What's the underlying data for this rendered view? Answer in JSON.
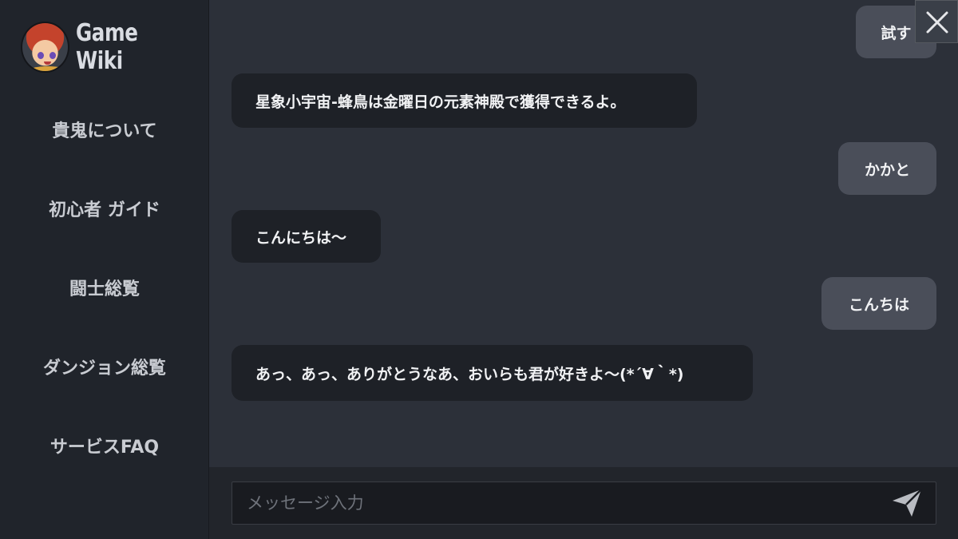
{
  "app": {
    "title": "Game Wiki"
  },
  "sidebar": {
    "items": [
      {
        "label": "貴鬼について"
      },
      {
        "label": "初心者 ガイド"
      },
      {
        "label": "闘士総覧"
      },
      {
        "label": "ダンジョン総覧"
      },
      {
        "label": "サービスFAQ"
      }
    ]
  },
  "chat": {
    "messages": [
      {
        "role": "user",
        "text": "試す"
      },
      {
        "role": "bot",
        "text": "星象小宇宙-蜂鳥は金曜日の元素神殿で獲得できるよ。"
      },
      {
        "role": "user",
        "text": "かかと"
      },
      {
        "role": "bot",
        "text": "こんにちは〜"
      },
      {
        "role": "user",
        "text": "こんちは"
      },
      {
        "role": "bot",
        "text": "あっ、あっ、ありがとうなあ、おいらも君が好きよ〜(*´∀｀*)"
      }
    ]
  },
  "composer": {
    "placeholder": "メッセージ入力",
    "value": ""
  },
  "icons": {
    "close": "close-icon",
    "send": "send-icon",
    "avatar": "avatar-icon"
  },
  "colors": {
    "background": "#2c3039",
    "sidebar": "#20242b",
    "user_bubble": "#4a4e59",
    "bot_bubble": "#1e2127"
  }
}
